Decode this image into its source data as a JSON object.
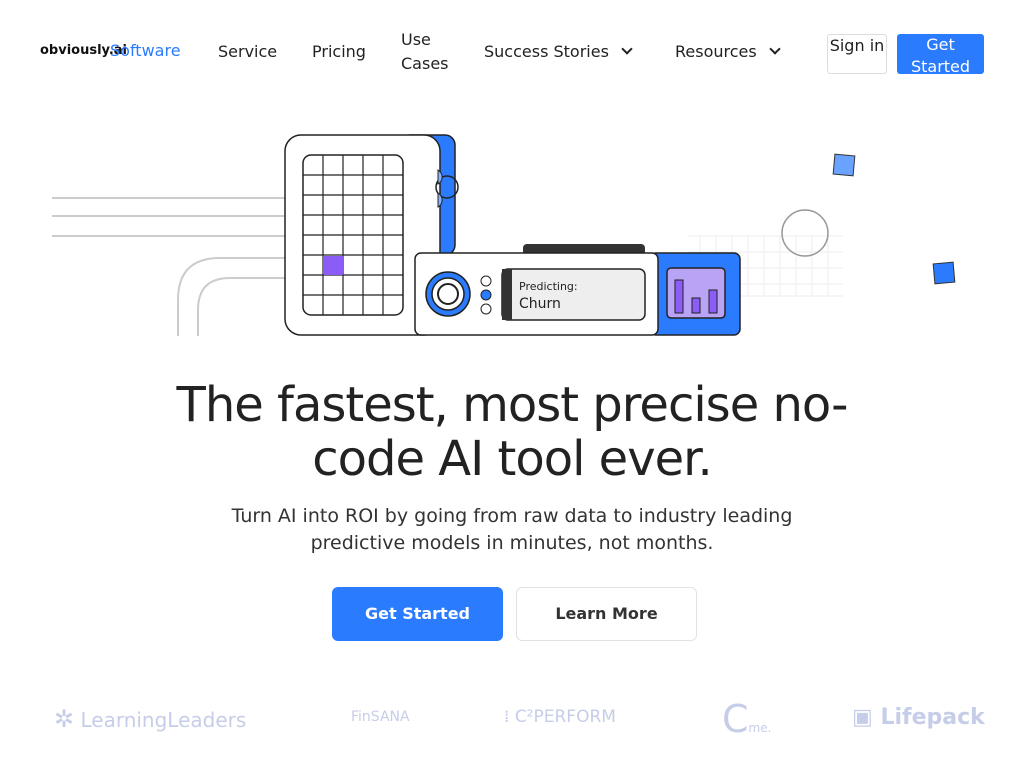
{
  "nav": {
    "logo": "obviously.ai",
    "logo_suffix": "Software",
    "items": [
      "Service",
      "Pricing",
      "Use Cases",
      "Success Stories",
      "Resources"
    ],
    "sign_in": "Sign in",
    "get_started": "Get Started"
  },
  "illustration": {
    "predicting_label": "Predicting:",
    "predicting_value": "Churn",
    "accent": "#2b7bff",
    "highlight": "#8b5cf6"
  },
  "hero": {
    "title": "The fastest, most precise no-code AI tool ever.",
    "subtitle": "Turn AI into ROI by going from raw data to industry leading predictive models in minutes, not months.",
    "cta_primary": "Get Started",
    "cta_secondary": "Learn More"
  },
  "logos": [
    "LearningLeaders",
    "FinSANA",
    "C²PERFORM",
    "me.",
    "Lifepack"
  ]
}
